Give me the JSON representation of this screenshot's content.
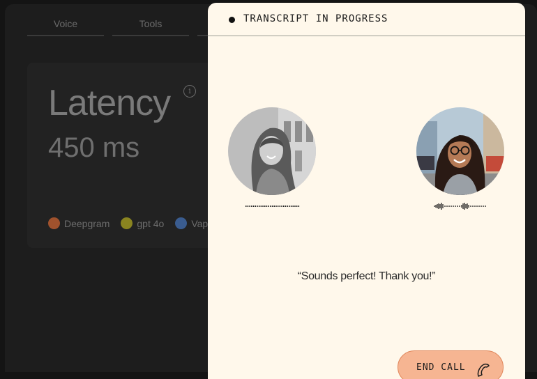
{
  "background": {
    "tabs": [
      {
        "label": "Voice"
      },
      {
        "label": "Tools"
      }
    ],
    "latency": {
      "title": "Latency",
      "value": "450 ms",
      "providers": [
        {
          "label": "Deepgram",
          "color": "#a0522d"
        },
        {
          "label": "gpt 4o",
          "color": "#8a8420"
        },
        {
          "label": "Vapi",
          "color": "#3a5c8f"
        }
      ]
    }
  },
  "panel": {
    "status": "TRANSCRIPT IN PROGRESS",
    "quote": "“Sounds perfect! Thank you!”",
    "end_call_label": "END CALL",
    "colors": {
      "panel_bg": "#fff8eb",
      "button_bg": "#f6b592"
    }
  }
}
